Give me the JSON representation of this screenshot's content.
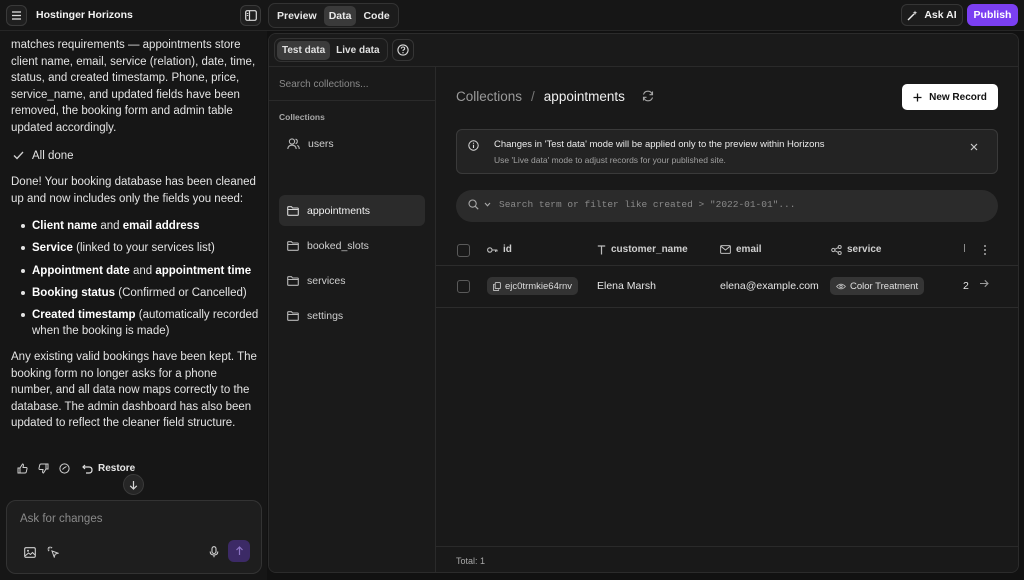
{
  "topbar": {
    "app_title": "Hostinger Horizons",
    "tabs": [
      {
        "label": "Preview"
      },
      {
        "label": "Data"
      },
      {
        "label": "Code"
      }
    ],
    "ask_ai_label": "Ask AI",
    "publish_label": "Publish",
    "publish_color": "#7b3ff2"
  },
  "chat": {
    "intro_text": "matches requirements — appointments store client name, email, service (relation), date, time, status, and created timestamp. Phone, price, service_name, and updated fields have been removed, the booking form and admin table updated accordingly.",
    "status_text": "All done",
    "summary_text": "Done! Your booking database has been cleaned up and now includes only the fields you need:",
    "bullets": [
      {
        "bold1": "Client name",
        "mid": " and ",
        "bold2": "email address",
        "rest": ""
      },
      {
        "bold1": "Service",
        "mid": " (linked to your services list)",
        "bold2": "",
        "rest": ""
      },
      {
        "bold1": "Appointment date",
        "mid": " and ",
        "bold2": "appointment time",
        "rest": ""
      },
      {
        "bold1": "Booking status",
        "mid": " (Confirmed or Cancelled)",
        "bold2": "",
        "rest": ""
      },
      {
        "bold1": "Created timestamp",
        "mid": " (automatically recorded when the booking is made)",
        "bold2": "",
        "rest": ""
      }
    ],
    "closing_text": "Any existing valid bookings have been kept. The booking form no longer asks for a phone number, and all data now maps correctly to the database. The admin dashboard has also been updated to reflect the cleaner field structure.",
    "restore_label": "Restore",
    "composer_placeholder": "Ask for changes"
  },
  "data_panel": {
    "mode_tabs": [
      {
        "label": "Test data"
      },
      {
        "label": "Live data"
      }
    ],
    "collections": {
      "search_placeholder": "Search collections...",
      "heading": "Collections",
      "items": [
        {
          "label": "users",
          "icon": "users-icon"
        },
        {
          "label": "appointments",
          "icon": "folder-icon"
        },
        {
          "label": "booked_slots",
          "icon": "folder-icon"
        },
        {
          "label": "services",
          "icon": "folder-icon"
        },
        {
          "label": "settings",
          "icon": "folder-icon"
        }
      ],
      "active": "appointments"
    },
    "breadcrumb": {
      "root": "Collections",
      "separator": "/",
      "current": "appointments"
    },
    "new_record_label": "New Record",
    "notice": {
      "title": "Changes in 'Test data' mode will be applied only to the preview within Horizons",
      "subtitle": "Use 'Live data' mode to adjust records for your published site."
    },
    "filter_placeholder": "Search term or filter like created > \"2022-01-01\"...",
    "table": {
      "columns": [
        {
          "label": "id",
          "icon": "key-icon"
        },
        {
          "label": "customer_name",
          "icon": "text-type-icon"
        },
        {
          "label": "email",
          "icon": "mail-icon"
        },
        {
          "label": "service",
          "icon": "relation-icon"
        }
      ],
      "rows": [
        {
          "id": "ejc0trmkie64rnv",
          "customer_name": "Elena Marsh",
          "email": "elena@example.com",
          "service": "Color Treatment",
          "truncated": "2"
        }
      ]
    },
    "footer_total": "Total: 1"
  }
}
